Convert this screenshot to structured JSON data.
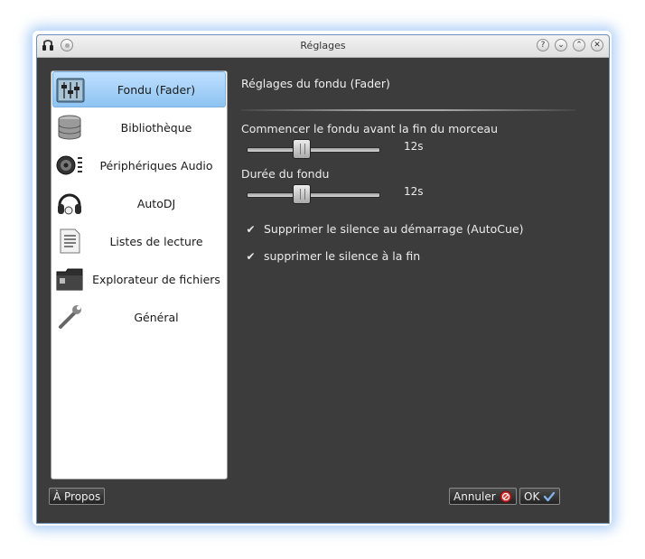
{
  "window": {
    "title": "Réglages"
  },
  "sidebar": {
    "items": [
      {
        "label": "Fondu (Fader)",
        "icon": "fader-icon",
        "selected": true
      },
      {
        "label": "Bibliothèque",
        "icon": "database-icon",
        "selected": false
      },
      {
        "label": "Périphériques Audio",
        "icon": "speaker-icon",
        "selected": false
      },
      {
        "label": "AutoDJ",
        "icon": "headphones-icon",
        "selected": false
      },
      {
        "label": "Listes de lecture",
        "icon": "document-list-icon",
        "selected": false
      },
      {
        "label": "Explorateur de fichiers",
        "icon": "folder-icon",
        "selected": false
      },
      {
        "label": "Général",
        "icon": "wrench-icon",
        "selected": false
      }
    ]
  },
  "main": {
    "section_title": "Réglages du fondu (Fader)",
    "fade_before_end": {
      "label": "Commencer le fondu avant la fin du morceau",
      "value": "12s"
    },
    "fade_duration": {
      "label": "Durée du fondu",
      "value": "12s"
    },
    "checkboxes": [
      {
        "label": "Supprimer le silence au démarrage (AutoCue)",
        "checked": true
      },
      {
        "label": "supprimer le silence à la fin",
        "checked": true
      }
    ]
  },
  "footer": {
    "about_label": "À Propos",
    "cancel_label": "Annuler",
    "ok_label": "OK"
  },
  "colors": {
    "accent": "#8ec3f2",
    "window_bg": "#3c3c3c"
  }
}
